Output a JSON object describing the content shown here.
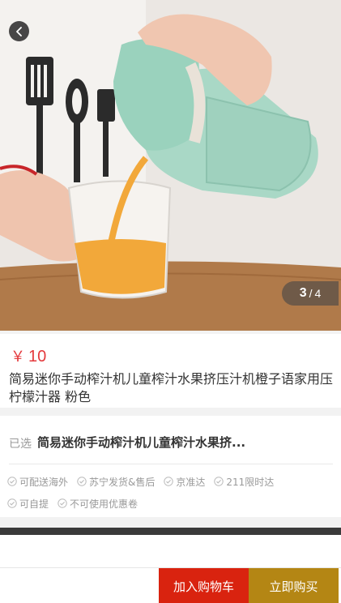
{
  "gallery": {
    "current": "3",
    "separator": "/",
    "total": "4",
    "image_description_icon": "juicer-product-photo"
  },
  "product": {
    "currency": "￥",
    "price": "10",
    "title": "简易迷你手动榨汁机儿童榨汁水果挤压汁机橙子语家用压柠檬汁器 粉色"
  },
  "selection": {
    "label": "已选",
    "value": "简易迷你手动榨汁机儿童榨汁水果挤..."
  },
  "services": [
    [
      "可配送海外",
      "苏宁发货&售后",
      "京准达",
      "211限时达"
    ],
    [
      "可自提",
      "不可使用优惠卷"
    ]
  ],
  "actions": {
    "add_to_cart": "加入购物车",
    "buy_now": "立即购买"
  },
  "colors": {
    "price": "#e4393c",
    "cart_button": "#d9230f",
    "buy_button": "#b48614"
  }
}
